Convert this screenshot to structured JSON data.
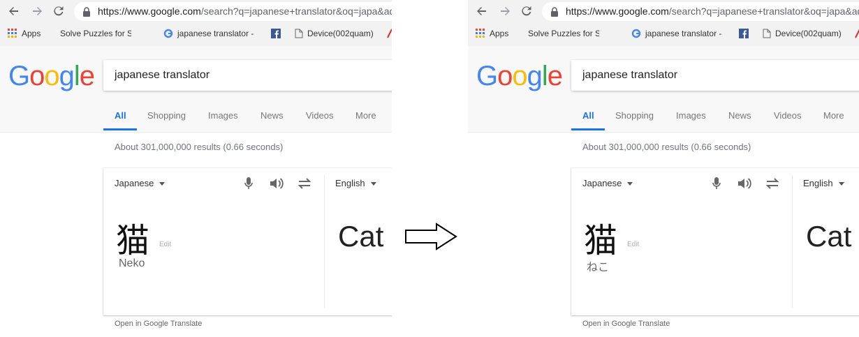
{
  "browser": {
    "url_host": "https://www.google.com",
    "url_rest": "/search?q=japanese+translator&oq=japa&aqs=chrome",
    "bookmarks": {
      "apps": "Apps",
      "solve": "Solve Puzzles for Scie",
      "japan": "japanese translator -",
      "device": "Device(002quam)"
    }
  },
  "search": {
    "query": "japanese translator",
    "tabs": [
      "All",
      "Shopping",
      "Images",
      "News",
      "Videos",
      "More"
    ],
    "stats": "About 301,000,000 results (0.66 seconds)"
  },
  "translator": {
    "source_lang": "Japanese",
    "target_lang": "English",
    "source_text": "猫",
    "edit_label": "Edit",
    "target_text": "Cat",
    "open_link": "Open in Google Translate"
  },
  "panels": {
    "left": {
      "transliteration": "Neko"
    },
    "right": {
      "transliteration": "ねこ"
    }
  },
  "colors": {
    "accent": "#1a73e8",
    "arrow": "#000000"
  }
}
